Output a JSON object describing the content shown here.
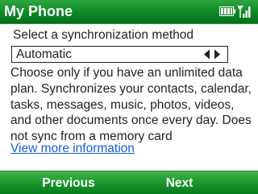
{
  "title_bar": {
    "title": "My Phone",
    "icons": [
      "battery-icon",
      "signal-strength-icon"
    ]
  },
  "sync": {
    "prompt": "Select a synchronization method",
    "selected_method": "Automatic",
    "description": "Choose only if you have an unlimited data plan. Synchronizes your contacts, calendar, tasks, messages, music, photos, videos, and other documents once every day. Does not sync from a memory card",
    "more_info_link": "View more information"
  },
  "softkeys": {
    "left": "Previous",
    "right": "Next"
  },
  "colors": {
    "title_bar": "#0d8a26",
    "softkey_bar": "#1c9a2e",
    "link": "#1a5fd1",
    "text": "#222222"
  }
}
